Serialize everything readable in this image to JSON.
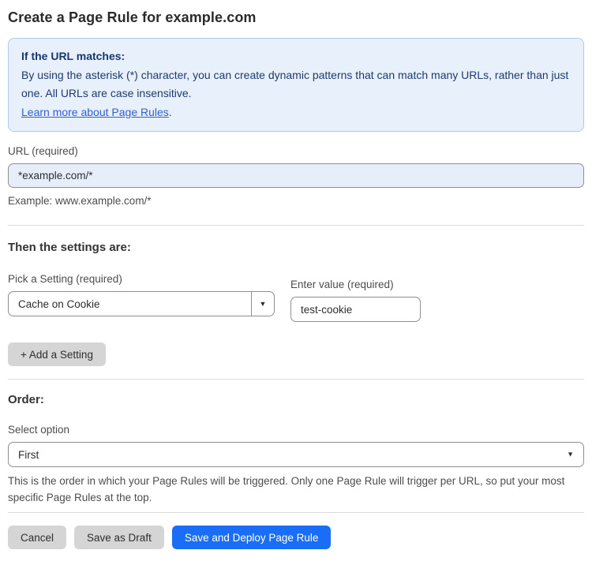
{
  "page": {
    "title": "Create a Page Rule for example.com"
  },
  "info_box": {
    "heading": "If the URL matches:",
    "body": "By using the asterisk (*) character, you can create dynamic patterns that can match many URLs, rather than just one. All URLs are case insensitive.",
    "link_label": "Learn more about Page Rules",
    "link_suffix": "."
  },
  "url_field": {
    "label": "URL (required)",
    "value": "*example.com/*",
    "helper": "Example: www.example.com/*"
  },
  "settings_section": {
    "heading": "Then the settings are:",
    "setting_label": "Pick a Setting (required)",
    "setting_value": "Cache on Cookie",
    "value_label": "Enter value (required)",
    "value_value": "test-cookie",
    "add_button_label": "+ Add a Setting"
  },
  "order_section": {
    "heading": "Order:",
    "select_label": "Select option",
    "select_value": "First",
    "helper": "This is the order in which your Page Rules will be triggered. Only one Page Rule will trigger per URL, so put your most specific Page Rules at the top."
  },
  "footer": {
    "cancel_label": "Cancel",
    "save_draft_label": "Save as Draft",
    "save_deploy_label": "Save and Deploy Page Rule"
  },
  "icons": {
    "dropdown_arrow": "▼"
  },
  "colors": {
    "accent_blue": "#1a6ef5",
    "info_background": "#e8f1fb",
    "info_border": "#aacbee",
    "info_text": "#1e3a6e",
    "link_blue": "#2d5fd0",
    "url_input_tint": "#e7eefb",
    "gray_button": "#d5d5d5"
  }
}
